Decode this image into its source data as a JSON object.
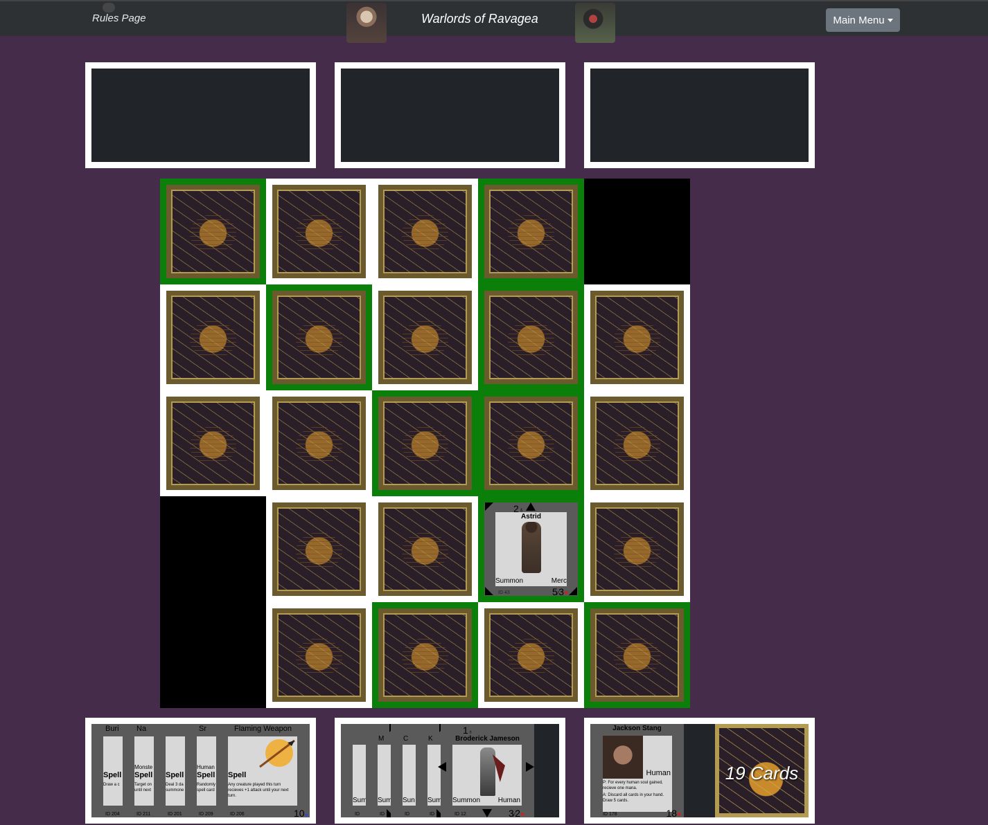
{
  "nav": {
    "rules_link": "Rules Page",
    "title": "Warlords of Ravagea",
    "menu_button": "Main Menu"
  },
  "board": {
    "rows": 5,
    "cols": 5,
    "cells": [
      [
        "back-green",
        "back",
        "back",
        "back-green",
        "void"
      ],
      [
        "back",
        "back-green",
        "back",
        "back-green",
        "back"
      ],
      [
        "back",
        "back",
        "back-green",
        "back-green",
        "back"
      ],
      [
        "void",
        "back",
        "back",
        "creature",
        "back"
      ],
      [
        "void",
        "back",
        "back-green",
        "back",
        "back-green"
      ]
    ],
    "creature": {
      "name": "Astrid",
      "mana": "2",
      "type": "Summon",
      "race": "Merc",
      "id": "ID 43",
      "attack": "5",
      "health": "3"
    }
  },
  "hand_left": {
    "cards": [
      {
        "title": "Buri",
        "type": "Spell",
        "text": "Draw a c",
        "id": "ID 204"
      },
      {
        "title": "Na",
        "sub": "Monste",
        "type": "Spell",
        "text": "Target on until next",
        "id": "ID 211"
      },
      {
        "title": "",
        "type": "Spell",
        "text": "Deal 3 da summone",
        "id": "ID 201"
      },
      {
        "title": "Sr",
        "sub": "Human",
        "type": "Spell",
        "text": "Randomly spell card",
        "id": "ID 209"
      },
      {
        "title": "Flaming Weapon",
        "type": "Spell",
        "text": "Any creature played this turn recieves +1 attack until your next turn.",
        "id": "ID 206",
        "cost": "10"
      }
    ]
  },
  "hand_mid": {
    "cards": [
      {
        "title": "",
        "type": "Sum",
        "id": "ID"
      },
      {
        "title": "M",
        "type": "Sum",
        "id": "ID"
      },
      {
        "title": "C",
        "type": "Sun",
        "id": "ID"
      },
      {
        "title": "K",
        "type": "Sum",
        "id": "ID"
      },
      {
        "title": "Broderick Jameson",
        "mana": "1",
        "type": "Summon",
        "race": "Human",
        "id": "ID 12",
        "attack": "3",
        "health": "2"
      }
    ]
  },
  "player": {
    "name": "Jackson Stang",
    "race": "Human",
    "text_p": "P: For every human soul gained, recieve one mana.",
    "text_a": "A: Discard all cards in your hand. Draw 5 cards.",
    "id": "ID 178",
    "health": "18",
    "deck_count": "19 Cards"
  },
  "colors": {
    "background": "#452c4a",
    "navbar": "#2e3134",
    "green_highlight": "#0a800a",
    "panel_dark": "#212429"
  }
}
